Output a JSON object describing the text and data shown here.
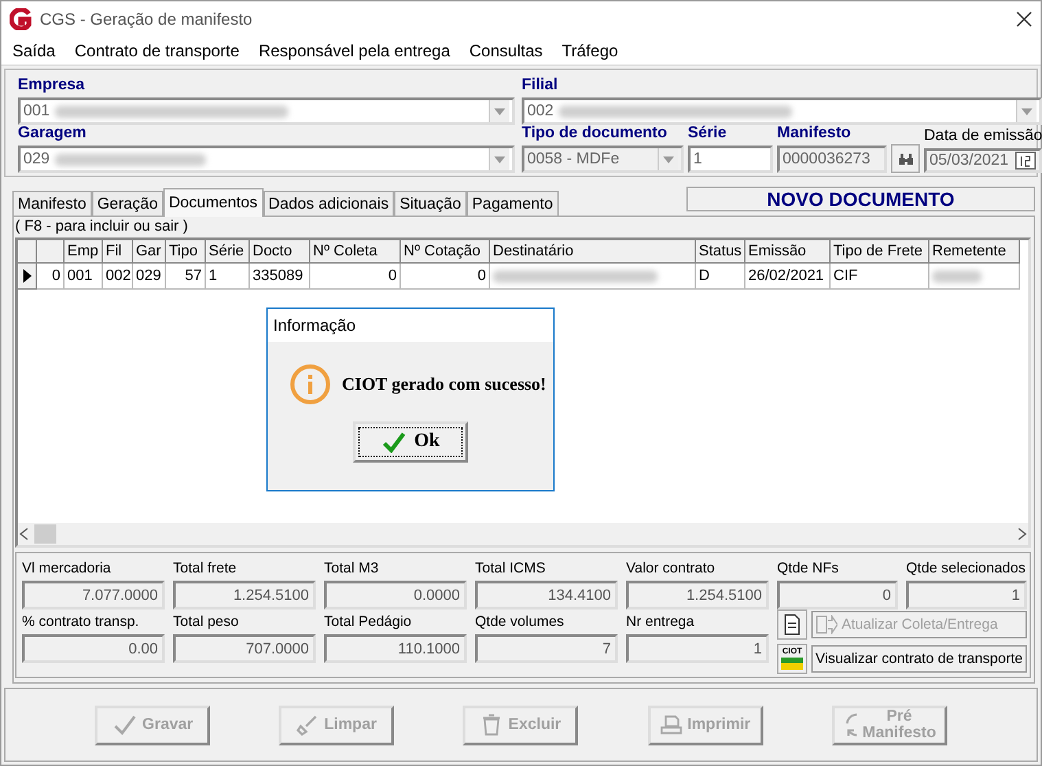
{
  "window": {
    "title": "CGS - Geração de manifesto"
  },
  "menu": [
    "Saída",
    "Contrato de transporte",
    "Responsável pela entrega",
    "Consultas",
    "Tráfego"
  ],
  "header": {
    "empresa": {
      "label": "Empresa",
      "value": "001",
      "redacted": true
    },
    "filial": {
      "label": "Filial",
      "value": "002",
      "redacted": true
    },
    "garagem": {
      "label": "Garagem",
      "value": "029",
      "redacted": true
    },
    "tipo_documento": {
      "label": "Tipo de documento",
      "value": "0058 - MDFe"
    },
    "serie": {
      "label": "Série",
      "value": "1"
    },
    "manifesto": {
      "label": "Manifesto",
      "value": "0000036273"
    },
    "data_emissao": {
      "label": "Data de emissão",
      "value": "05/03/2021"
    }
  },
  "status_banner": "NOVO DOCUMENTO",
  "tabs": [
    {
      "label": "Manifesto",
      "selected": false
    },
    {
      "label": "Geração",
      "selected": false
    },
    {
      "label": "Documentos",
      "selected": true
    },
    {
      "label": "Dados adicionais",
      "selected": false
    },
    {
      "label": "Situação",
      "selected": false
    },
    {
      "label": "Pagamento",
      "selected": false
    }
  ],
  "hint": "( F8 - para incluir ou sair )",
  "table": {
    "columns": [
      "",
      "Emp",
      "Fil",
      "Gar",
      "Tipo",
      "Série",
      "Docto",
      "Nº Coleta",
      "Nº Cotação",
      "Destinatário",
      "Status",
      "Emissão",
      "Tipo de Frete",
      "Remetente"
    ],
    "rows": [
      {
        "current": true,
        "cells": [
          {
            "text": "0"
          },
          {
            "text": "001"
          },
          {
            "text": "002"
          },
          {
            "text": "029"
          },
          {
            "text": "57"
          },
          {
            "text": "1"
          },
          {
            "text": "335089"
          },
          {
            "text": "0"
          },
          {
            "text": "0"
          },
          {
            "redacted": true
          },
          {
            "text": "D"
          },
          {
            "text": "26/02/2021"
          },
          {
            "text": "CIF"
          },
          {
            "redacted": true
          }
        ]
      }
    ]
  },
  "totals": [
    [
      {
        "label": "Vl mercadoria",
        "value": "7.077.0000"
      },
      {
        "label": "Total frete",
        "value": "1.254.5100"
      },
      {
        "label": "Total M3",
        "value": "0.0000"
      },
      {
        "label": "Total ICMS",
        "value": "134.4100"
      },
      {
        "label": "Valor contrato",
        "value": "1.254.5100"
      },
      {
        "label": "Qtde NFs",
        "value": "0"
      },
      {
        "label": "Qtde selecionados",
        "value": "1"
      }
    ],
    [
      {
        "label": "% contrato transp.",
        "value": "0.00"
      },
      {
        "label": "Total peso",
        "value": "707.0000"
      },
      {
        "label": "Total Pedágio",
        "value": "110.1000"
      },
      {
        "label": "Qtde volumes",
        "value": "7"
      },
      {
        "label": "Nr entrega",
        "value": "1"
      }
    ]
  ],
  "side_actions": [
    {
      "label": "Atualizar Coleta/Entrega",
      "disabled": true
    },
    {
      "label": "Visualizar contrato de transporte",
      "disabled": false,
      "icon_text": "CIOT"
    }
  ],
  "buttons": [
    {
      "label": "Gravar",
      "disabled": true,
      "kind": "save"
    },
    {
      "label": "Limpar",
      "disabled": true,
      "kind": "clear"
    },
    {
      "label": "Excluir",
      "disabled": true,
      "kind": "delete"
    },
    {
      "label": "Imprimir",
      "disabled": true,
      "kind": "print"
    },
    {
      "label": "Pré Manifesto",
      "disabled": true,
      "kind": "refresh"
    }
  ],
  "dialog": {
    "title": "Informação",
    "message": "CIOT gerado com sucesso!",
    "button": "Ok"
  }
}
